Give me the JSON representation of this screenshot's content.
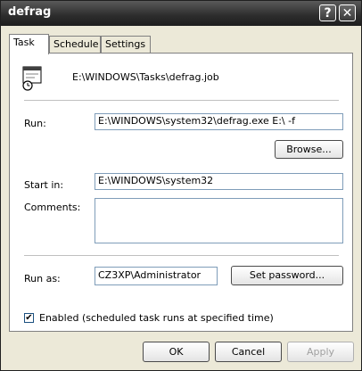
{
  "window": {
    "title": "defrag"
  },
  "titlebar": {
    "help_glyph": "?",
    "close_glyph": "✕"
  },
  "tabs": [
    {
      "label": "Task",
      "active": true
    },
    {
      "label": "Schedule",
      "active": false
    },
    {
      "label": "Settings",
      "active": false
    }
  ],
  "task": {
    "job_path": "E:\\WINDOWS\\Tasks\\defrag.job",
    "run_label": "Run:",
    "run_value": "E:\\WINDOWS\\system32\\defrag.exe E:\\ -f",
    "browse_label": "Browse...",
    "start_in_label": "Start in:",
    "start_in_value": "E:\\WINDOWS\\system32",
    "comments_label": "Comments:",
    "comments_value": "",
    "run_as_label": "Run as:",
    "run_as_value": "CZ3XP\\Administrator",
    "set_password_label": "Set password...",
    "enabled_label": "Enabled (scheduled task runs at specified time)",
    "enabled_checked": true,
    "check_glyph": "✔"
  },
  "footer": {
    "ok_label": "OK",
    "cancel_label": "Cancel",
    "apply_label": "Apply"
  },
  "icons": [
    "help-icon",
    "close-icon",
    "task-job-icon",
    "checkmark-icon"
  ]
}
